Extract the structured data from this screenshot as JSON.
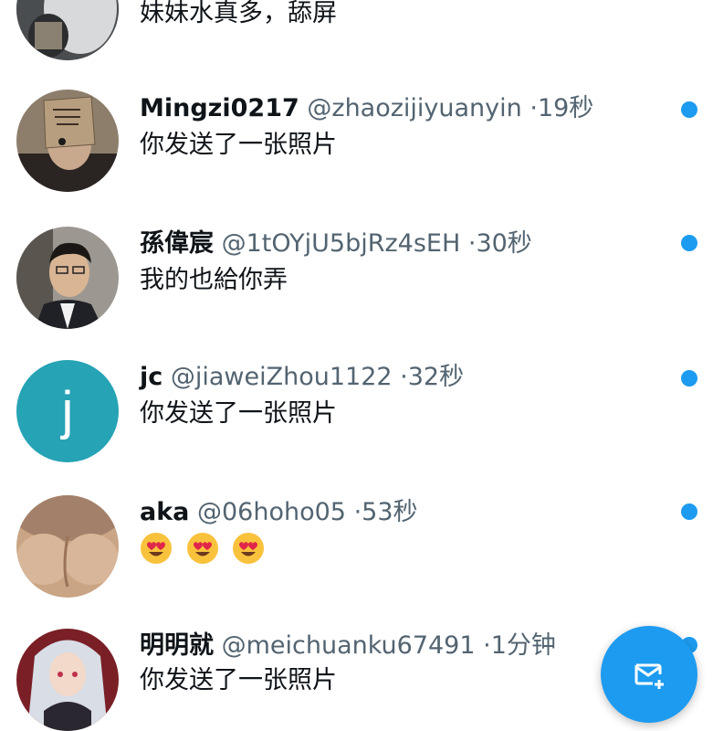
{
  "messages": [
    {
      "name": "",
      "handle": "",
      "time": "",
      "preview": "妹妹水真多，舔屏",
      "avatar_icon": "avatar-photo-icon",
      "unread": false
    },
    {
      "name": "Mingzi0217",
      "handle": "@zhaozijiyuanyin",
      "time": "19秒",
      "preview": "你发送了一张照片",
      "avatar_icon": "avatar-photo-icon",
      "unread": true
    },
    {
      "name": "孫偉宸",
      "handle": "@1tOYjU5bjRz4sEH",
      "time": "30秒",
      "preview": "我的也給你弄",
      "avatar_icon": "avatar-photo-icon",
      "unread": true
    },
    {
      "name": "jc",
      "handle": "@jiaweiZhou1122",
      "time": "32秒",
      "preview": "你发送了一张照片",
      "avatar_letter": "j",
      "avatar_color": "#26a3b5",
      "unread": true
    },
    {
      "name": "aka",
      "handle": "@06hoho05",
      "time": "53秒",
      "preview": "",
      "emoji_count": 3,
      "emoji_icon": "heart-eyes-emoji-icon",
      "avatar_icon": "avatar-photo-icon",
      "unread": true
    },
    {
      "name": "明明就",
      "handle": "@meichuanku67491",
      "time": "1分钟",
      "preview": "你发送了一张照片",
      "avatar_icon": "avatar-photo-icon",
      "unread": true
    }
  ],
  "separator": "·",
  "fab_icon": "new-message-icon",
  "accent_color": "#1d9bf0"
}
